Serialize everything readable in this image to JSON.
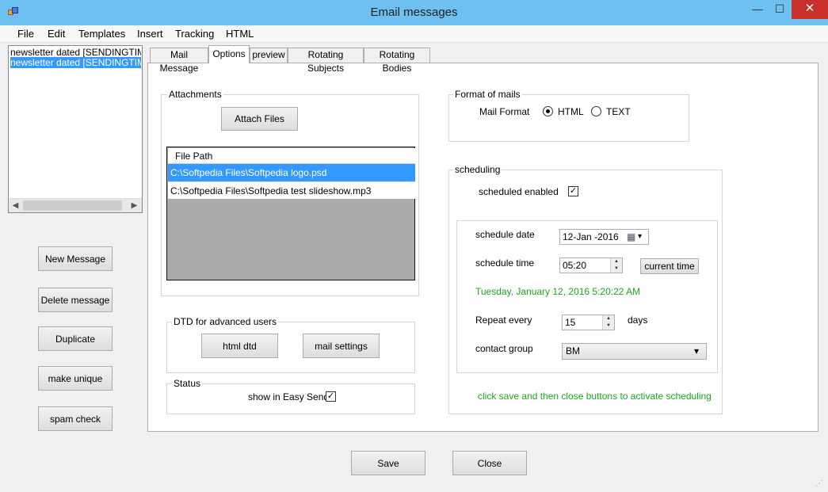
{
  "window": {
    "title": "Email messages",
    "minimize_glyph": "—",
    "maximize_glyph": "☐",
    "close_glyph": "✕"
  },
  "menu": [
    "File",
    "Edit",
    "Templates",
    "Insert",
    "Tracking",
    "HTML"
  ],
  "messages": [
    {
      "label": "newsletter dated [SENDINGTIME]",
      "selected": false
    },
    {
      "label": "newsletter dated [SENDINGTIME]",
      "selected": true
    }
  ],
  "side_buttons": {
    "new_message": "New Message",
    "delete_message": "Delete message",
    "duplicate": "Duplicate",
    "make_unique": "make unique",
    "spam_check": "spam check"
  },
  "tabs": [
    "Mail Message",
    "Options",
    "preview",
    "Rotating Subjects",
    "Rotating Bodies"
  ],
  "active_tab": "Options",
  "attachments": {
    "group_label": "Attachments",
    "attach_button": "Attach Files",
    "column_header": "File Path",
    "files": [
      "C:\\Softpedia Files\\Softpedia logo.psd",
      "C:\\Softpedia Files\\Softpedia test slideshow.mp3"
    ]
  },
  "dtd": {
    "group_label": "DTD for advanced users",
    "html_dtd_button": "html dtd",
    "mail_settings_button": "mail settings"
  },
  "status": {
    "group_label": "Status",
    "show_in_easy_send_label": "show in Easy Send",
    "show_in_easy_send_checked": true
  },
  "format": {
    "group_label": "Format of mails",
    "mail_format_label": "Mail Format",
    "option_html": "HTML",
    "option_text": "TEXT",
    "selected": "HTML"
  },
  "scheduling": {
    "group_label": "scheduling",
    "scheduled_enabled_label": "scheduled enabled",
    "scheduled_enabled_checked": true,
    "schedule_date_label": "schedule date",
    "schedule_date_value": "12-Jan -2016",
    "schedule_time_label": "schedule time",
    "schedule_time_value": "05:20",
    "current_time_button": "current time",
    "current_datetime_text": "Tuesday, January 12, 2016 5:20:22 AM",
    "repeat_every_label": "Repeat every",
    "repeat_every_value": "15",
    "repeat_unit": "days",
    "contact_group_label": "contact group",
    "contact_group_value": "BM",
    "hint_text": "click save and then close buttons to activate scheduling"
  },
  "footer": {
    "save_button": "Save",
    "close_button": "Close"
  },
  "colors": {
    "titlebar": "#6ec0f0",
    "selection": "#3399ff",
    "close_button": "#c7302b",
    "green_text": "#1ea61e"
  },
  "glyphs": {
    "check": "✓",
    "arrow_left": "◀",
    "arrow_right": "▶",
    "spin_up": "▲",
    "spin_down": "▼",
    "dropdown": "▾",
    "calendar": "▦",
    "grip": "⋰"
  }
}
